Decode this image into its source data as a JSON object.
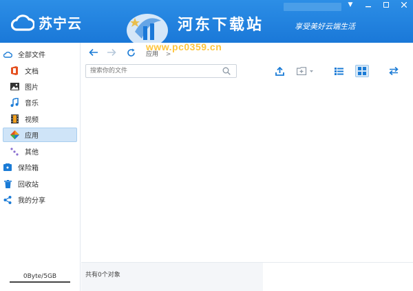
{
  "app": {
    "name": "苏宁云"
  },
  "watermark": {
    "title": "河东下载站",
    "slogan": "享受美好云端生活",
    "url": "www.pc0359.cn"
  },
  "sidebar": {
    "items": [
      {
        "label": "全部文件",
        "icon": "cloud-icon"
      },
      {
        "label": "文档",
        "icon": "office-doc-icon"
      },
      {
        "label": "图片",
        "icon": "image-icon"
      },
      {
        "label": "音乐",
        "icon": "music-note-icon"
      },
      {
        "label": "视频",
        "icon": "film-icon"
      },
      {
        "label": "应用",
        "icon": "app-grid-icon"
      },
      {
        "label": "其他",
        "icon": "dots-icon"
      },
      {
        "label": "保险箱",
        "icon": "safe-icon"
      },
      {
        "label": "回收站",
        "icon": "trash-icon"
      },
      {
        "label": "我的分享",
        "icon": "share-icon"
      }
    ],
    "active": "应用",
    "storage": "0Byte/5GB"
  },
  "breadcrumb": {
    "current": "应用",
    "separator": ">"
  },
  "search": {
    "placeholder": "搜索你的文件"
  },
  "status": {
    "text": "共有0个对象"
  },
  "colors": {
    "titlebar": "#1f82e0",
    "accent": "#1a7bd6",
    "active_bg": "#cfe4f8"
  }
}
